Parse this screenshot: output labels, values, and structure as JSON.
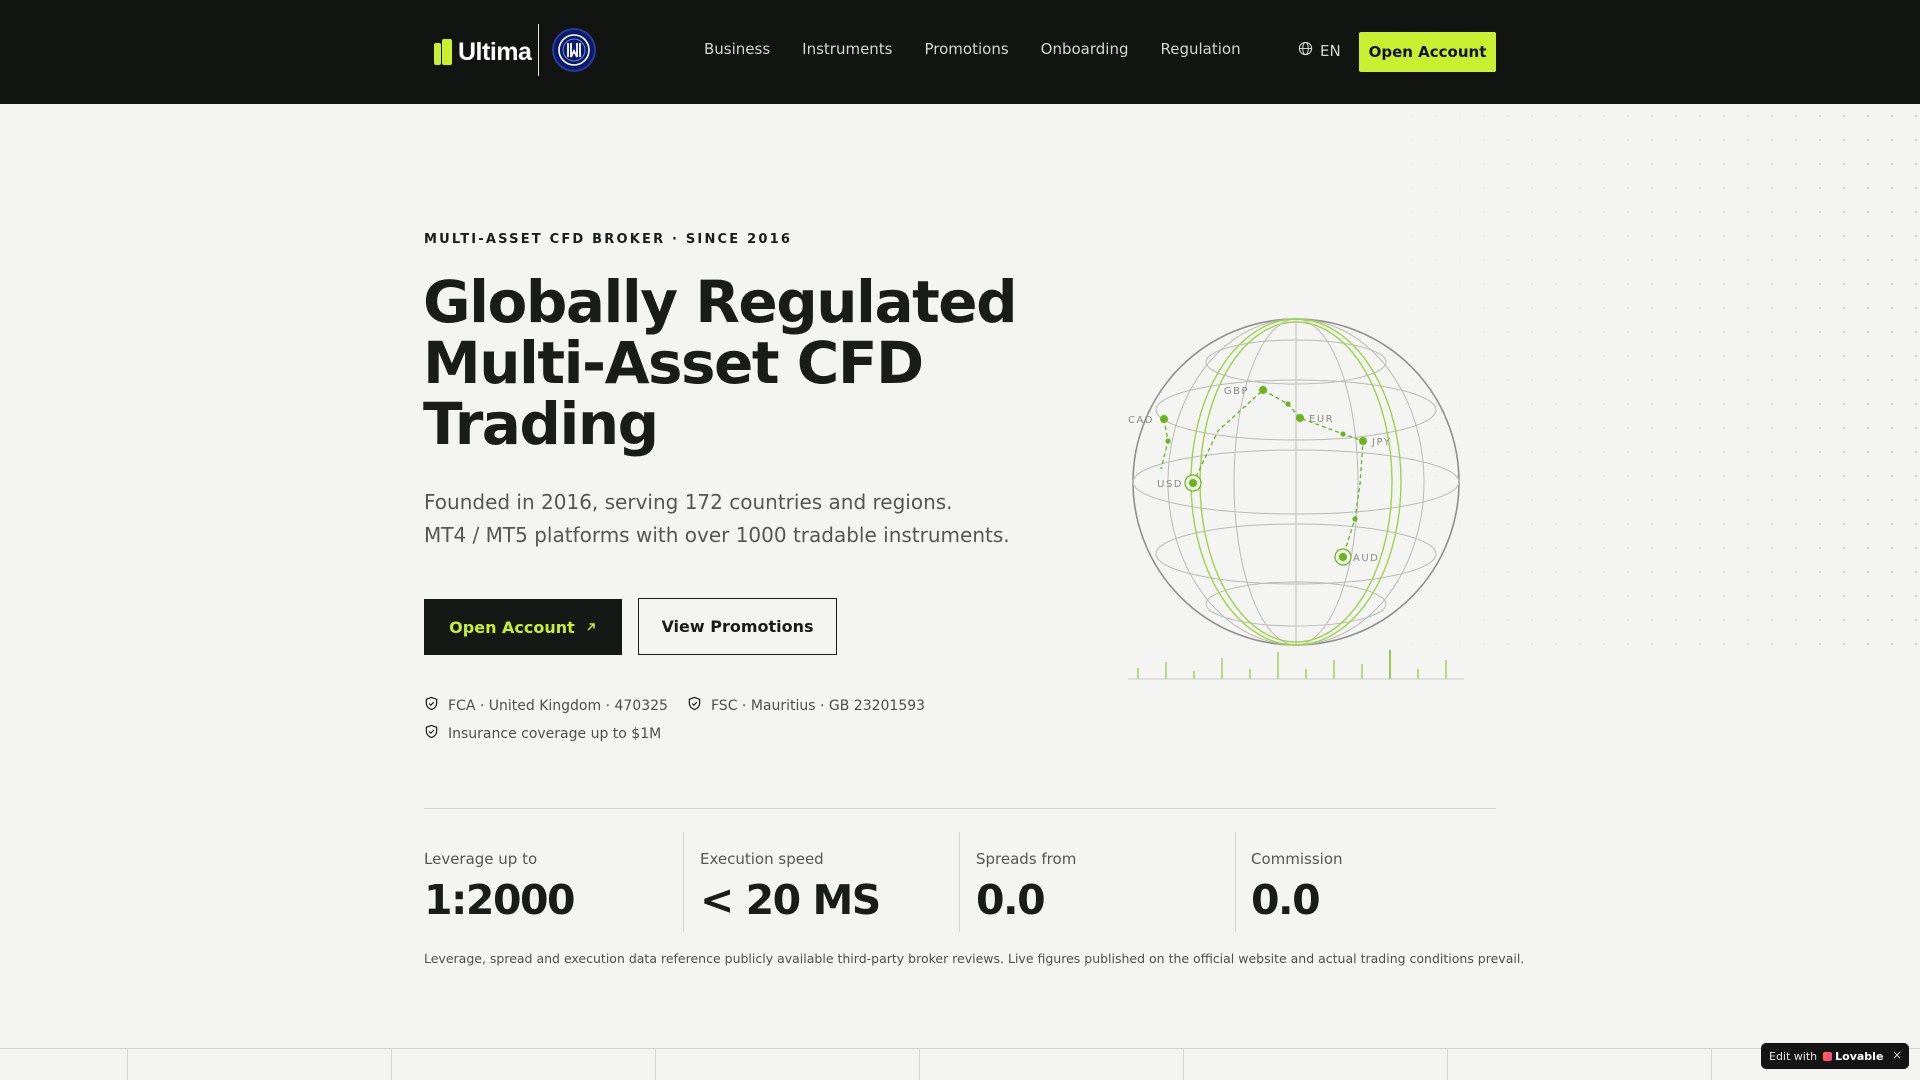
{
  "header": {
    "brand_name": "Ultima",
    "nav": [
      "Business",
      "Instruments",
      "Promotions",
      "Onboarding",
      "Regulation"
    ],
    "language": "EN",
    "cta_label": "Open Account"
  },
  "hero": {
    "eyebrow": "MULTI-ASSET CFD BROKER · SINCE 2016",
    "title_lines": [
      "Globally Regulated",
      "Multi-Asset CFD",
      "Trading"
    ],
    "subtitle_lines": [
      "Founded in 2016, serving 172 countries and regions.",
      "MT4 / MT5 platforms with over 1000 tradable instruments."
    ],
    "primary_button": "Open Account",
    "secondary_button": "View Promotions",
    "regulation": [
      "FCA · United Kingdom · 470325",
      "FSC · Mauritius · GB 23201593",
      "Insurance coverage up to $1M"
    ]
  },
  "globe": {
    "currencies": [
      "CAD",
      "GBP",
      "EUR",
      "JPY",
      "USD",
      "AUD"
    ],
    "accent_color": "#6ab41e"
  },
  "stats": [
    {
      "label": "Leverage up to",
      "value": "1:2000"
    },
    {
      "label": "Execution speed",
      "value": "< 20 MS"
    },
    {
      "label": "Spreads from",
      "value": "0.0"
    },
    {
      "label": "Commission",
      "value": "0.0"
    }
  ],
  "disclaimer": "Leverage, spread and execution data reference publicly available third-party broker reviews. Live figures published on the official website and actual trading conditions prevail.",
  "badge": {
    "edit_with": "Edit with",
    "name": "Lovable",
    "close": "×"
  },
  "colors": {
    "header_bg": "#121411",
    "accent": "#c8f030",
    "page_bg": "#f4f4f3",
    "text": "#1a1c1a"
  }
}
